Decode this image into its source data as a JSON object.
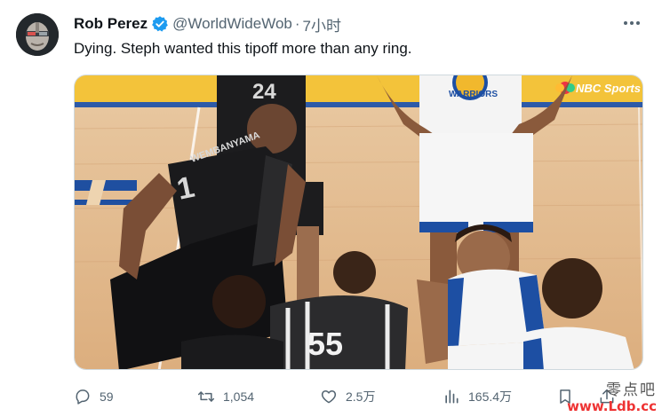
{
  "tweet": {
    "author": {
      "display_name": "Rob Perez",
      "handle": "@WorldWideWob",
      "verified": true,
      "avatar_icon": "avatar-portrait"
    },
    "separator": "·",
    "time": "7小时",
    "text": "Dying. Steph wanted this tipoff more than any ring.",
    "media": {
      "broadcaster_logo": "NBC Sports",
      "jersey_numbers": [
        "24",
        "1",
        "55"
      ],
      "jersey_name": "WEMBANYAMA",
      "team_name": "WARRIORS"
    }
  },
  "actions": {
    "reply_count": "59",
    "retweet_count": "1,054",
    "like_count": "2.5万",
    "view_count": "165.4万"
  },
  "colors": {
    "accent": "#1d9bf0",
    "muted_text": "#536471",
    "main_text": "#0f1419"
  },
  "watermark": {
    "top": "零点吧",
    "bottom": "www.Ldb.cc"
  }
}
